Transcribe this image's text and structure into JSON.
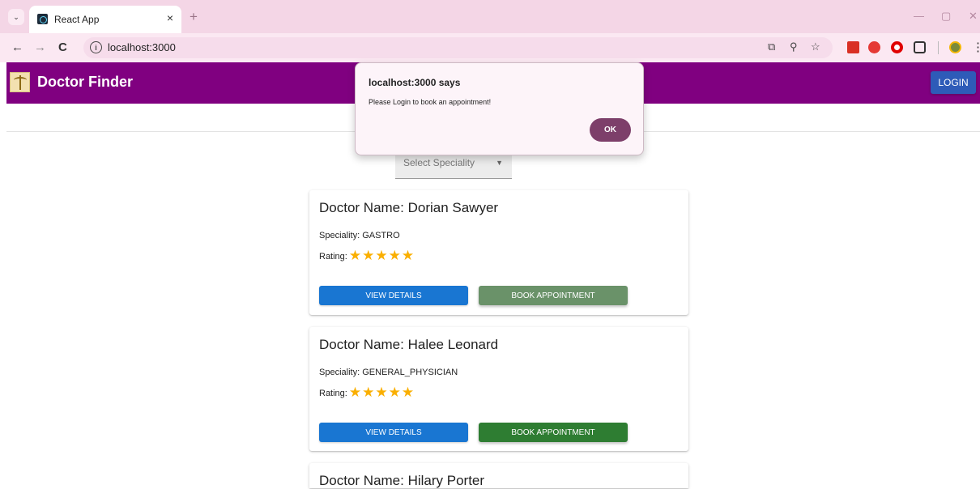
{
  "browser": {
    "tab_title": "React App",
    "tab_close": "×",
    "new_tab": "+",
    "url": "localhost:3000",
    "minimize": "—",
    "restore": "▢",
    "close_window": "✕",
    "back": "←",
    "forward": "→",
    "reload": "C"
  },
  "header": {
    "title": "Doctor Finder",
    "login_label": "LOGIN",
    "bar_color": "#800080"
  },
  "filter": {
    "placeholder": "Select Speciality"
  },
  "doctors": [
    {
      "name": "Doctor Name: Dorian Sawyer",
      "speciality": "Speciality: GASTRO",
      "rating_label": "Rating:",
      "stars": "★★★★★",
      "rating_value": 5,
      "view_label": "VIEW DETAILS",
      "book_label": "BOOK APPOINTMENT"
    },
    {
      "name": "Doctor Name: Halee Leonard",
      "speciality": "Speciality: GENERAL_PHYSICIAN",
      "rating_label": "Rating:",
      "stars": "★★★★★",
      "rating_value": 5,
      "view_label": "VIEW DETAILS",
      "book_label": "BOOK APPOINTMENT"
    },
    {
      "name": "Doctor Name: Hilary Porter"
    }
  ],
  "dialog": {
    "title": "localhost:3000 says",
    "message": "Please Login to book an appointment!",
    "ok_label": "OK"
  },
  "colors": {
    "view_button": "#1976d2",
    "book_button": "#2e7d32",
    "book_button_hover": "#6a9269",
    "star": "#faaf00"
  }
}
